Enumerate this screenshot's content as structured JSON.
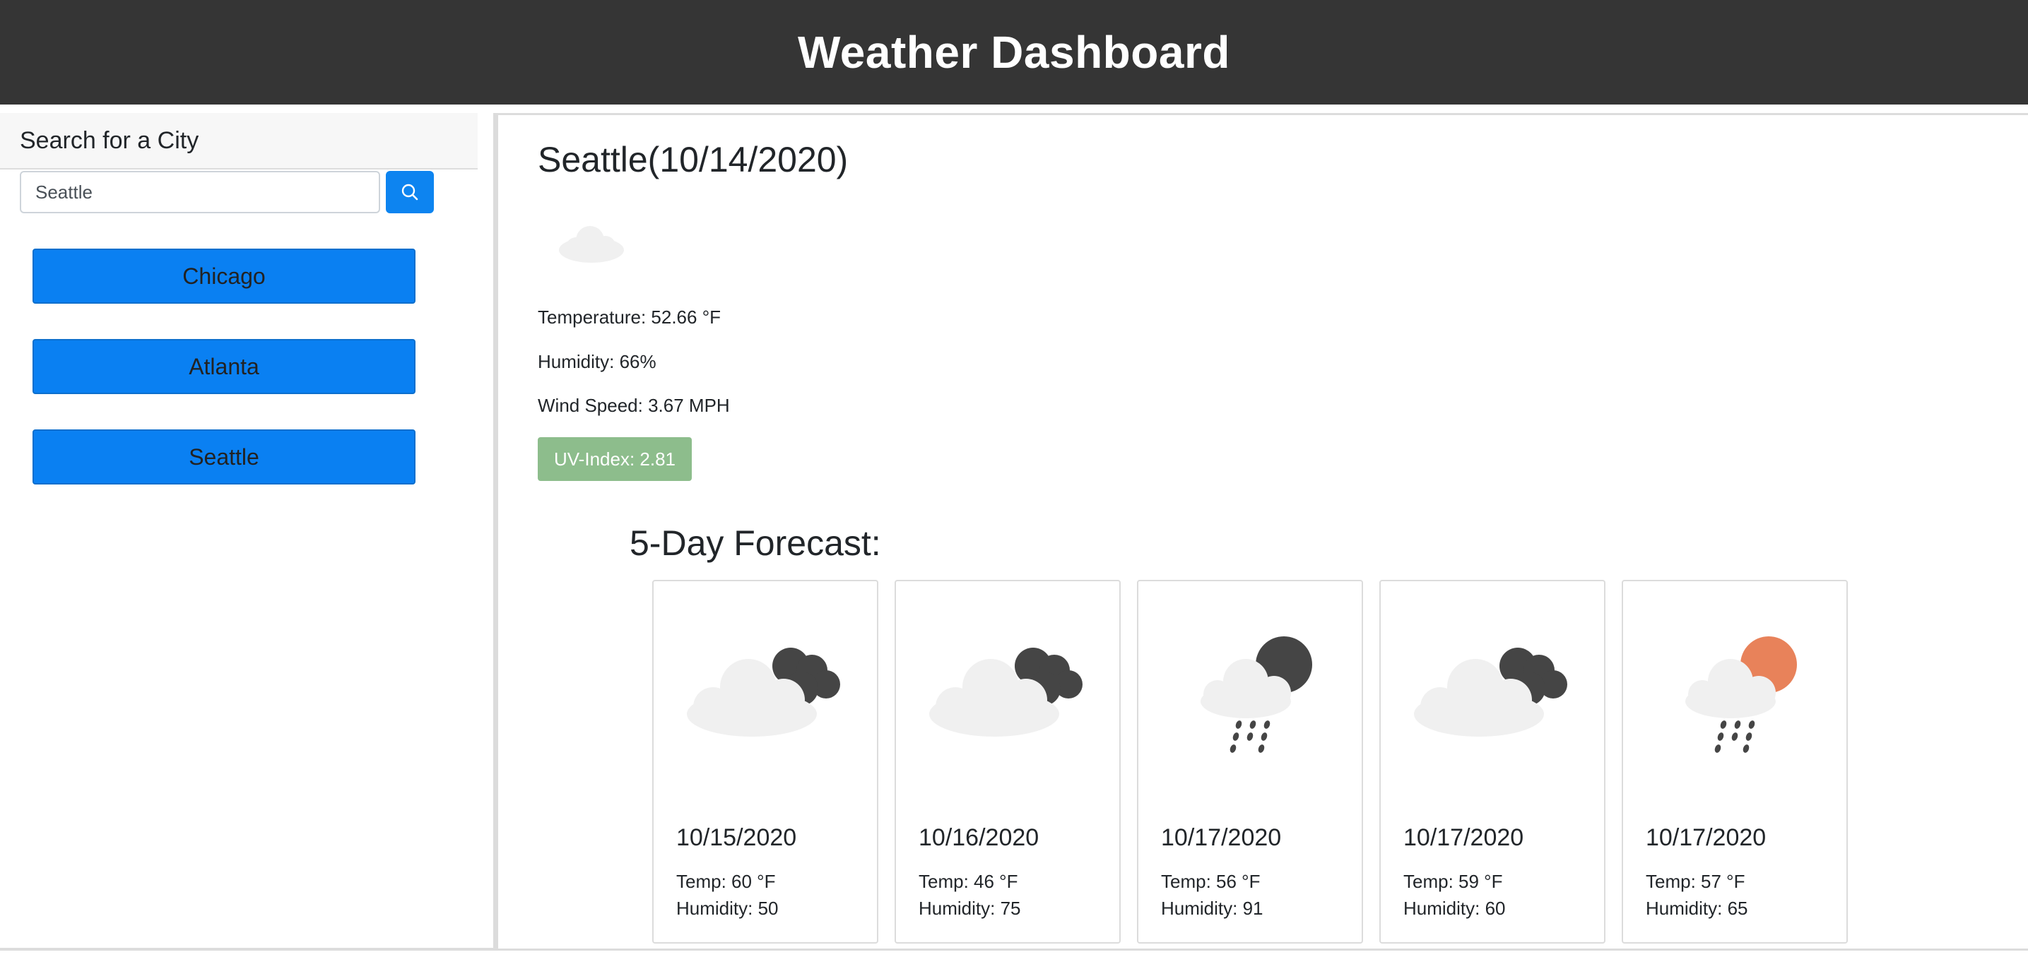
{
  "header": {
    "title": "Weather Dashboard"
  },
  "sidebar": {
    "title": "Search for a City",
    "search": {
      "value": "Seattle",
      "placeholder": "",
      "button_icon": "search-icon"
    },
    "history": [
      {
        "label": "Chicago"
      },
      {
        "label": "Atlanta"
      },
      {
        "label": "Seattle"
      }
    ]
  },
  "current": {
    "title": "Seattle(10/14/2020)",
    "icon": "cloud-icon",
    "temperature": "Temperature: 52.66 °F",
    "humidity": "Humidity: 66%",
    "wind": "Wind Speed: 3.67 MPH",
    "uv": "UV-Index: 2.81",
    "uv_color": "#8dbd8c"
  },
  "forecast": {
    "heading": "5-Day Forecast:",
    "days": [
      {
        "date": "10/15/2020",
        "temp": "Temp: 60 °F",
        "humidity": "Humidity: 50",
        "icon": "cloudy-night-icon"
      },
      {
        "date": "10/16/2020",
        "temp": "Temp: 46 °F",
        "humidity": "Humidity: 75",
        "icon": "cloudy-night-icon"
      },
      {
        "date": "10/17/2020",
        "temp": "Temp: 56 °F",
        "humidity": "Humidity: 91",
        "icon": "rain-night-icon"
      },
      {
        "date": "10/17/2020",
        "temp": "Temp: 59 °F",
        "humidity": "Humidity: 60",
        "icon": "cloudy-night-icon"
      },
      {
        "date": "10/17/2020",
        "temp": "Temp: 57 °F",
        "humidity": "Humidity: 65",
        "icon": "rain-day-icon"
      }
    ]
  },
  "colors": {
    "header_bg": "#353535",
    "primary_button": "#0a80f2",
    "uv_badge": "#8dbd8c",
    "sun": "#e8825a",
    "moon": "#454545",
    "cloud": "#f0f0f0"
  }
}
